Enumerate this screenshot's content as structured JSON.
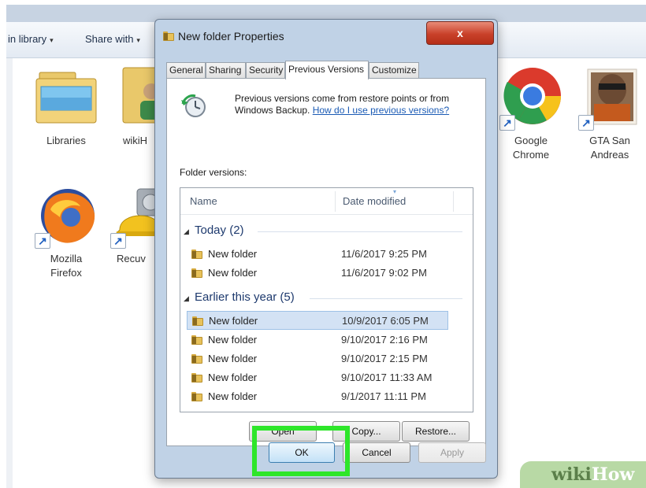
{
  "explorer": {
    "toolbar": {
      "include_library": "in library",
      "share_with": "Share with"
    },
    "icons": [
      {
        "label": "Libraries"
      },
      {
        "label": "wikiH"
      },
      {
        "label": "Mozilla Firefox",
        "line1": "Mozilla",
        "line2": "Firefox"
      },
      {
        "label": "Recuv"
      },
      {
        "label": "Google Chrome",
        "line1": "Google",
        "line2": "Chrome"
      },
      {
        "label": "GTA San Andreas",
        "line1": "GTA San",
        "line2": "Andreas"
      }
    ]
  },
  "dialog": {
    "title": "New folder Properties",
    "close_glyph": "x",
    "tabs": [
      "General",
      "Sharing",
      "Security",
      "Previous Versions",
      "Customize"
    ],
    "active_tab": "Previous Versions",
    "info_text": "Previous versions come from restore points or from Windows Backup.",
    "info_link": "How do I use previous versions?",
    "versions_label": "Folder versions:",
    "columns": {
      "name": "Name",
      "date": "Date modified"
    },
    "groups": [
      {
        "title": "Today (2)",
        "rows": [
          {
            "name": "New folder",
            "date": "11/6/2017 9:25 PM"
          },
          {
            "name": "New folder",
            "date": "11/6/2017 9:02 PM"
          }
        ]
      },
      {
        "title": "Earlier this year (5)",
        "rows": [
          {
            "name": "New folder",
            "date": "10/9/2017 6:05 PM",
            "selected": true
          },
          {
            "name": "New folder",
            "date": "9/10/2017 2:16 PM"
          },
          {
            "name": "New folder",
            "date": "9/10/2017 2:15 PM"
          },
          {
            "name": "New folder",
            "date": "9/10/2017 11:33 AM"
          },
          {
            "name": "New folder",
            "date": "9/1/2017 11:11 PM"
          }
        ]
      }
    ],
    "buttons": {
      "open": "Open",
      "copy": "Copy...",
      "restore": "Restore...",
      "ok": "OK",
      "cancel": "Cancel",
      "apply": "Apply"
    }
  },
  "watermark": {
    "wiki": "wiki",
    "how": "How"
  },
  "colors": {
    "highlight": "#2ee62a",
    "link": "#1b5bb5",
    "selected_row": "#d3e2f4"
  }
}
